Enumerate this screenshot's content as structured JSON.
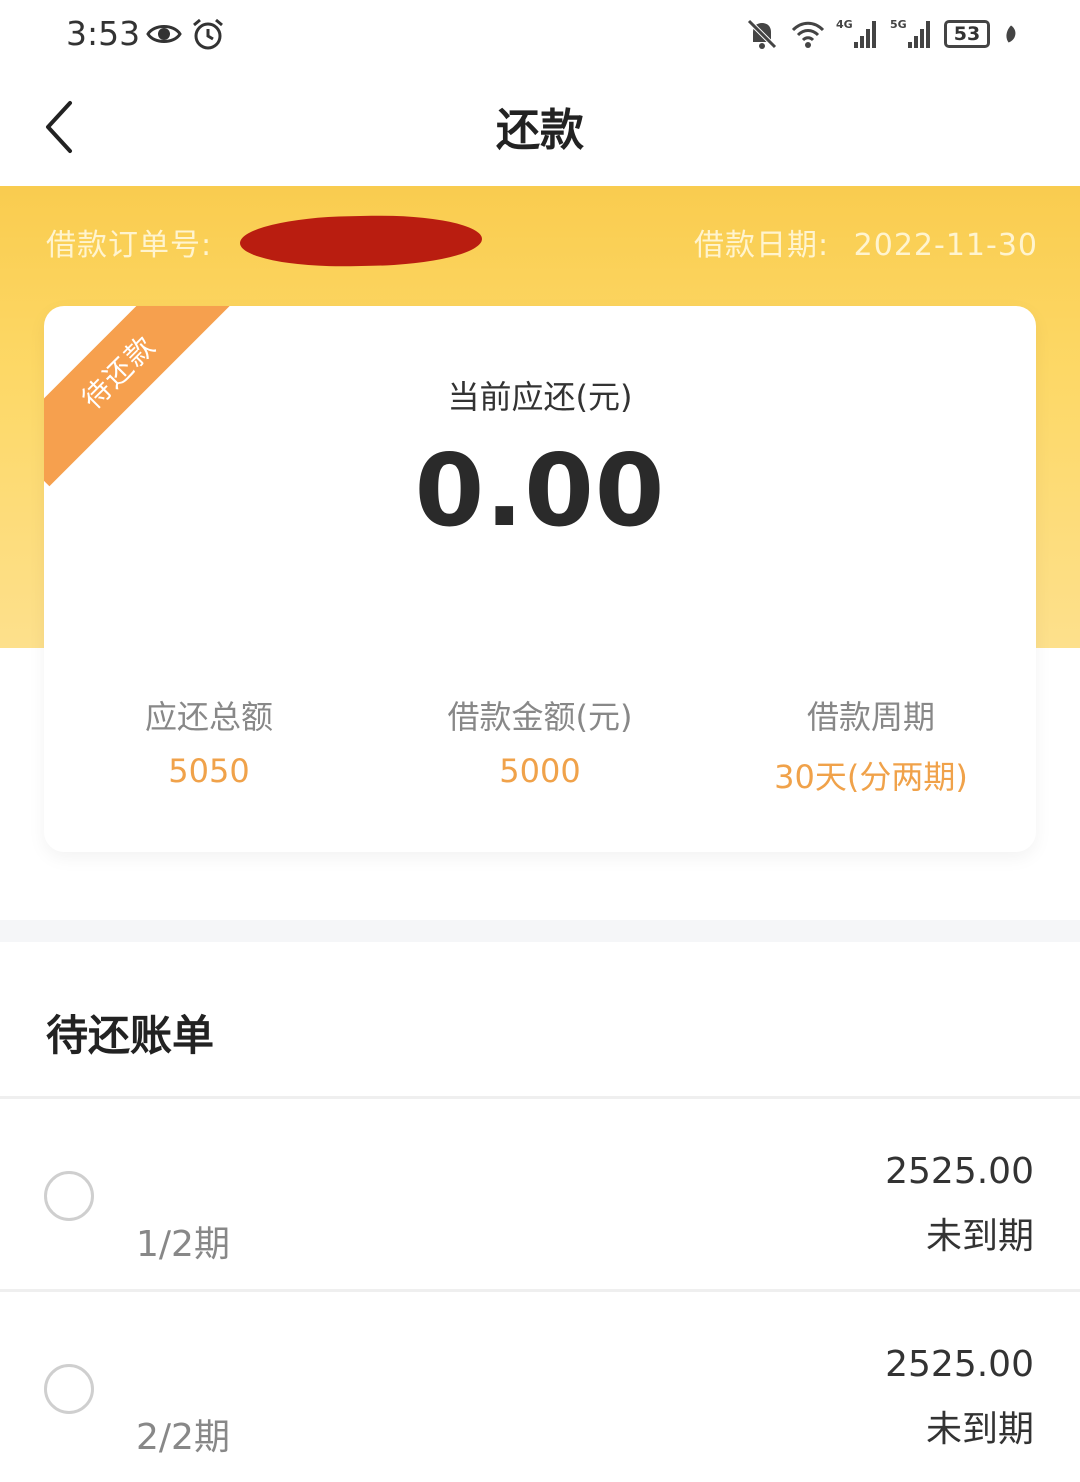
{
  "status_bar": {
    "time": "3:53",
    "left_icons": [
      "eye-icon",
      "alarm-icon"
    ],
    "right_icons": [
      "mute-icon",
      "wifi-icon",
      "signal-4g-icon",
      "signal-5g-icon",
      "battery-icon",
      "leaf-icon"
    ],
    "signal_4g_label": "4G",
    "signal_5g_label": "5G",
    "battery": "53"
  },
  "nav": {
    "title": "还款",
    "back_icon": "chevron-left-icon"
  },
  "header": {
    "order_label": "借款订单号:",
    "date_label": "借款日期:",
    "date_value": "2022-11-30"
  },
  "card": {
    "ribbon": "待还款",
    "current_label": "当前应还(元)",
    "current_amount": "0.00",
    "stats": [
      {
        "label": "应还总额",
        "value": "5050"
      },
      {
        "label": "借款金额(元)",
        "value": "5000"
      },
      {
        "label": "借款周期",
        "value": "30天(分两期)"
      }
    ]
  },
  "bills": {
    "title": "待还账单",
    "items": [
      {
        "period": "1/2期",
        "amount": "2525.00",
        "status": "未到期"
      },
      {
        "period": "2/2期",
        "amount": "2525.00",
        "status": "未到期"
      }
    ]
  },
  "colors": {
    "accent_orange": "#f0a24a",
    "ribbon": "#f6a04e",
    "header_yellow": "#fdd866"
  }
}
